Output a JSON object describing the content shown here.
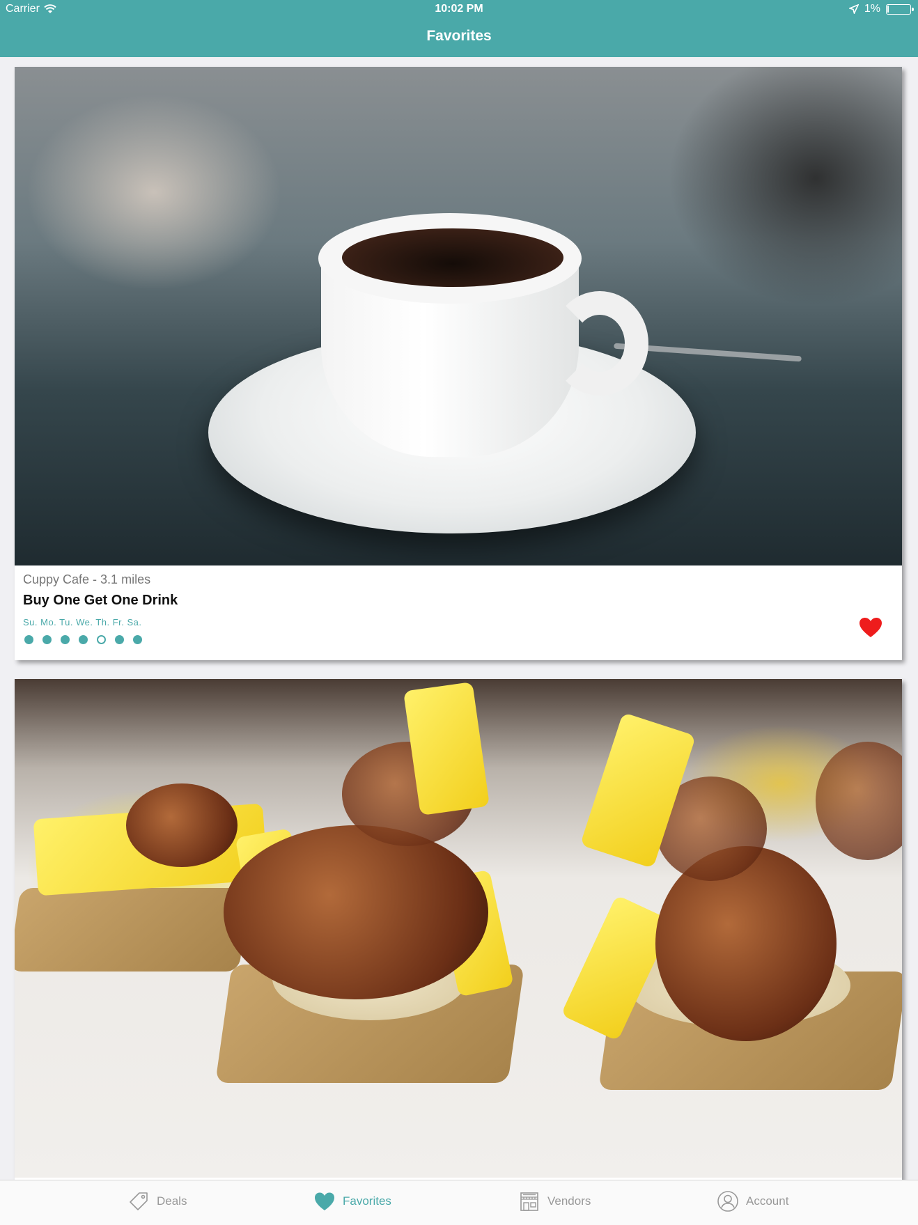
{
  "status_bar": {
    "carrier": "Carrier",
    "time": "10:02 PM",
    "battery": "1%"
  },
  "nav": {
    "title": "Favorites"
  },
  "cards": [
    {
      "vendor": "Cuppy Cafe - 3.1 miles",
      "deal": "Buy One Get One Drink",
      "days_label": "Su. Mo. Tu. We. Th. Fr. Sa.",
      "days_active": [
        true,
        true,
        true,
        true,
        false,
        true,
        true
      ],
      "favorited": true
    }
  ],
  "tabs": [
    {
      "label": "Deals",
      "icon": "tag-icon",
      "active": false
    },
    {
      "label": "Favorites",
      "icon": "heart-icon",
      "active": true
    },
    {
      "label": "Vendors",
      "icon": "storefront-icon",
      "active": false
    },
    {
      "label": "Account",
      "icon": "user-icon",
      "active": false
    }
  ],
  "colors": {
    "accent": "#4aa9a9",
    "heart": "#ee1c1c",
    "inactive_tab": "#999999"
  }
}
